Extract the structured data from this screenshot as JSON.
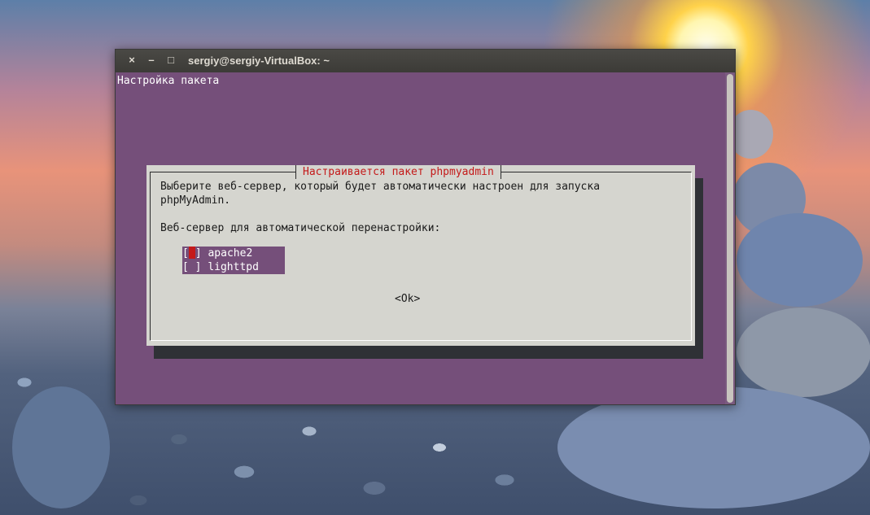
{
  "window": {
    "title": "sergiy@sergiy-VirtualBox: ~",
    "close_glyph": "×",
    "minimize_glyph": "–",
    "maximize_glyph": "□"
  },
  "terminal": {
    "header": "Настройка пакета"
  },
  "dialog": {
    "title": "Настраивается пакет phpmyadmin",
    "description_line1": "Выберите веб-сервер, который будет автоматически настроен для запуска",
    "description_line2": "phpMyAdmin.",
    "prompt": "Веб-сервер для автоматической перенастройки:",
    "options": [
      {
        "label": "apache2",
        "checked": false,
        "focused": true
      },
      {
        "label": "lighttpd",
        "checked": false,
        "focused": false
      }
    ],
    "ok_label": "<Ok>"
  },
  "colors": {
    "terminal_bg": "#754f7a",
    "dialog_bg": "#d5d5cf",
    "accent_red": "#c41a1a"
  }
}
